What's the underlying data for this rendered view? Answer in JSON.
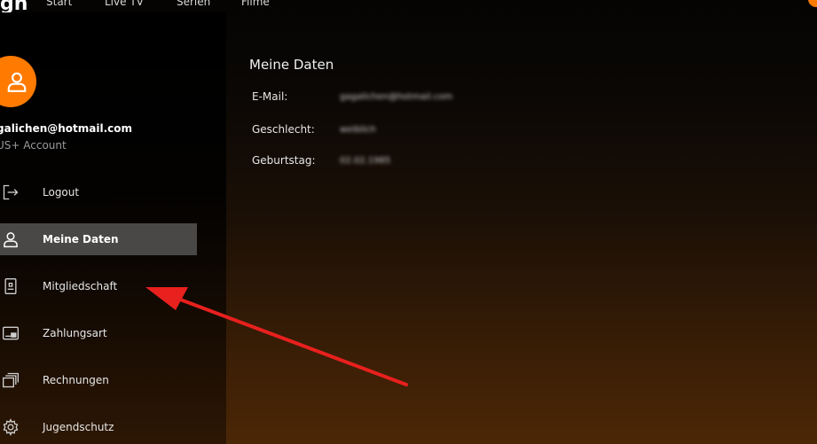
{
  "topnav": {
    "logo": "gn",
    "items": [
      "Start",
      "Live TV",
      "Serien",
      "Filme"
    ]
  },
  "user": {
    "email": "galichen@hotmail.com",
    "account": "US+ Account"
  },
  "sidebar": {
    "items": [
      {
        "label": "Logout",
        "icon": "logout-icon"
      },
      {
        "label": "Meine Daten",
        "icon": "user-icon",
        "active": true
      },
      {
        "label": "Mitgliedschaft",
        "icon": "membership-card-icon"
      },
      {
        "label": "Zahlungsart",
        "icon": "payment-card-icon"
      },
      {
        "label": "Rechnungen",
        "icon": "invoices-icon"
      },
      {
        "label": "Jugendschutz",
        "icon": "gear-icon"
      }
    ]
  },
  "main": {
    "title": "Meine Daten",
    "fields": [
      {
        "label": "E-Mail:",
        "value": "gagalichen@hotmail.com"
      },
      {
        "label": "Geschlecht:",
        "value": "weiblich"
      },
      {
        "label": "Geburtstag:",
        "value": "02.02.1985"
      }
    ]
  },
  "colors": {
    "accent": "#ff7a00",
    "active_item_bg": "#4a4847",
    "annotation_arrow": "#e8201e"
  }
}
